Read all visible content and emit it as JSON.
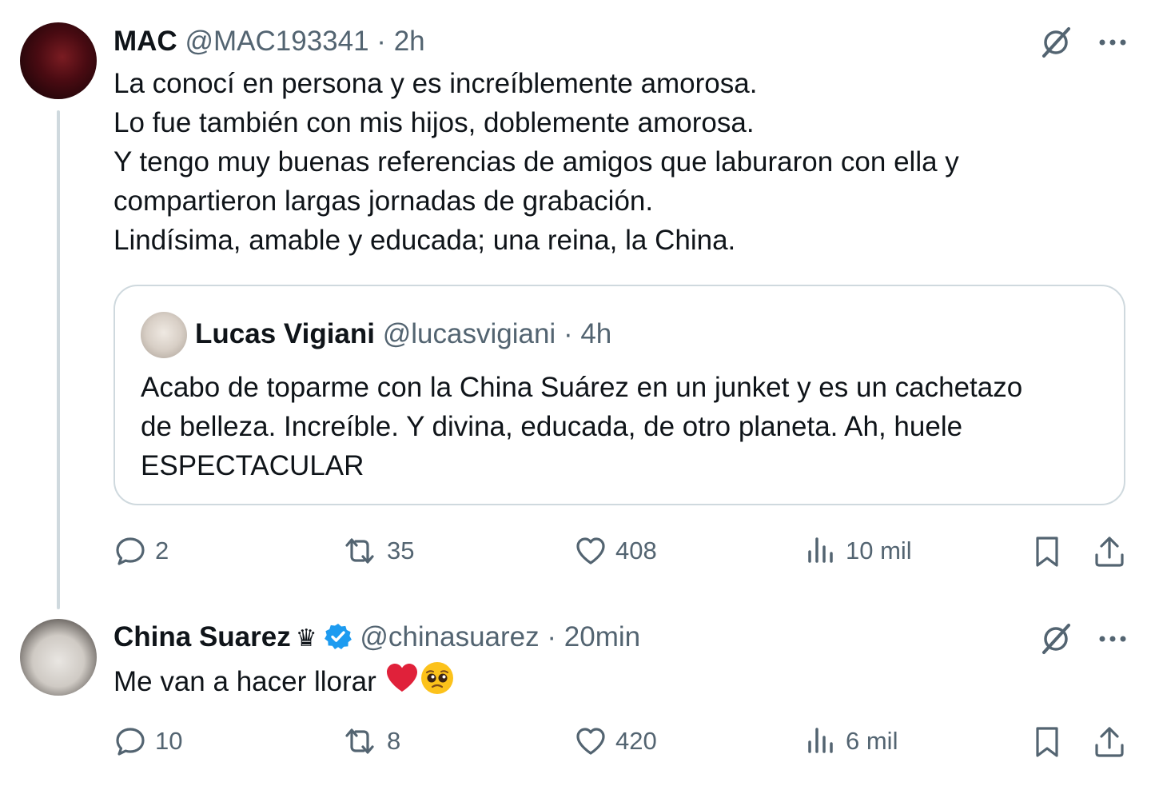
{
  "tweets": [
    {
      "name": "MAC",
      "handle": "@MAC193341",
      "separator": "·",
      "time": "2h",
      "lines": [
        "La conocí en persona y es increíblemente amorosa.",
        "Lo fue también con mis hijos, doblemente amorosa.",
        "Y tengo muy buenas referencias de amigos que laburaron con ella y",
        "compartieron largas jornadas de grabación.",
        "Lindísima, amable y educada; una reina, la China."
      ],
      "quote": {
        "name": "Lucas Vigiani",
        "handle": "@lucasvigiani",
        "separator": "·",
        "time": "4h",
        "lines": [
          "Acabo de toparme con la China Suárez en un junket y es un cachetazo",
          "de belleza. Increíble. Y divina, educada, de otro planeta. Ah, huele",
          "ESPECTACULAR"
        ]
      },
      "stats": {
        "replies": "2",
        "reposts": "35",
        "likes": "408",
        "views": "10 mil"
      }
    },
    {
      "name": "China Suarez",
      "crown": "♛",
      "handle": "@chinasuarez",
      "separator": "·",
      "time": "20min",
      "text": "Me van a hacer llorar",
      "stats": {
        "replies": "10",
        "reposts": "8",
        "likes": "420",
        "views": "6 mil"
      }
    }
  ],
  "colors": {
    "text": "#0f1419",
    "muted": "#536471",
    "border": "#cfd9de",
    "verified": "#1d9bf0"
  },
  "icons": [
    "grok-icon",
    "more-icon",
    "reply-icon",
    "repost-icon",
    "like-icon",
    "views-icon",
    "bookmark-icon",
    "share-icon",
    "verified-badge-icon",
    "red-heart-emoji",
    "pleading-face-emoji"
  ]
}
